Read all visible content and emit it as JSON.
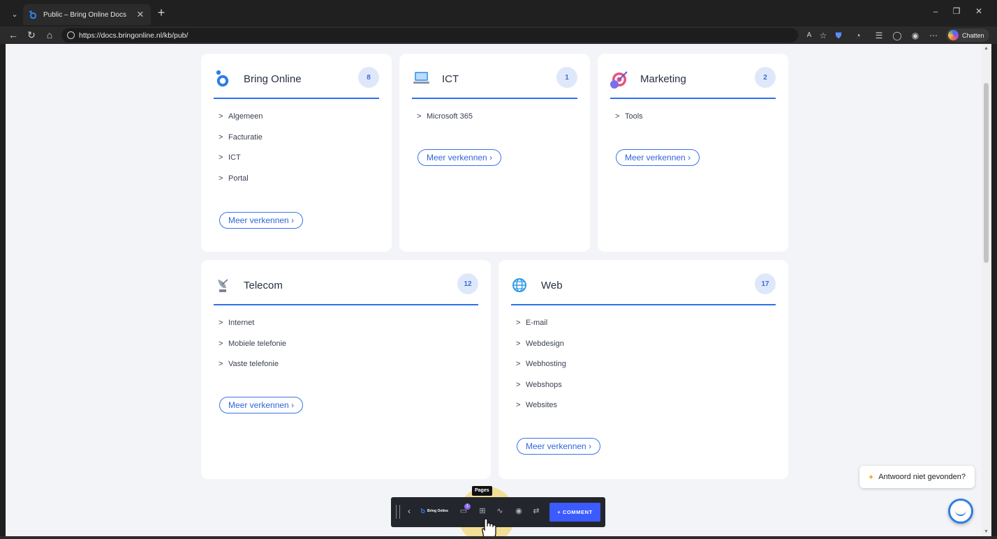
{
  "browser": {
    "tab_title": "Public – Bring Online Docs",
    "tab_close": "✕",
    "new_tab": "+",
    "url": "https://docs.bringonline.nl/kb/pub/",
    "chatten_label": "Chatten",
    "window_controls": {
      "minimize": "–",
      "restore": "❐",
      "close": "✕"
    },
    "nav_icons": [
      "back-arrow-icon",
      "refresh-icon",
      "home-icon",
      "lock-icon"
    ]
  },
  "categories": [
    {
      "title": "Bring Online",
      "count": "8",
      "icon": "bring-online-logo-icon",
      "items": [
        "Algemeen",
        "Facturatie",
        "ICT",
        "Portal"
      ],
      "more": "Meer verkennen"
    },
    {
      "title": "ICT",
      "count": "1",
      "icon": "laptop-icon",
      "items": [
        "Microsoft 365"
      ],
      "more": "Meer verkennen"
    },
    {
      "title": "Marketing",
      "count": "2",
      "icon": "target-icon",
      "items": [
        "Tools"
      ],
      "more": "Meer verkennen"
    },
    {
      "title": "Telecom",
      "count": "12",
      "icon": "satellite-dish-icon",
      "items": [
        "Internet",
        "Mobiele telefonie",
        "Vaste telefonie"
      ],
      "more": "Meer verkennen"
    },
    {
      "title": "Web",
      "count": "17",
      "icon": "globe-icon",
      "items": [
        "E-mail",
        "Webdesign",
        "Webhosting",
        "Webshops",
        "Websites"
      ],
      "more": "Meer verkennen"
    }
  ],
  "chevron": ">",
  "more_arrow": "›",
  "help": {
    "label": "Antwoord niet gevonden?"
  },
  "review_toolbar": {
    "tooltip": "Pages",
    "logo_text": "Bring Online",
    "notification_count": "1",
    "comment_button": "+ COMMENT"
  },
  "colors": {
    "accent": "#2f6fea",
    "badge_bg": "#dfe8fb",
    "page_bg": "#f3f4f7",
    "comment_button": "#3b5bff"
  }
}
